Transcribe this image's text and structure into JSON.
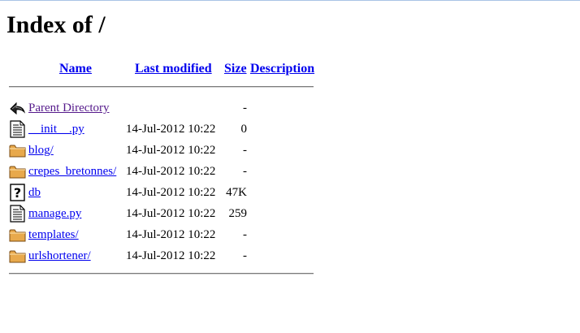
{
  "page": {
    "title": "Index of /"
  },
  "columns": {
    "name": "Name",
    "modified": "Last modified",
    "size": "Size",
    "description": "Description"
  },
  "rows": [
    {
      "icon": "back-icon",
      "name": "Parent Directory",
      "modified": "",
      "size": "-"
    },
    {
      "icon": "text-file-icon",
      "name": "__init__.py",
      "modified": "14-Jul-2012 10:22",
      "size": "0"
    },
    {
      "icon": "folder-icon",
      "name": "blog/",
      "modified": "14-Jul-2012 10:22",
      "size": "-"
    },
    {
      "icon": "folder-icon",
      "name": "crepes_bretonnes/",
      "modified": "14-Jul-2012 10:22",
      "size": "-"
    },
    {
      "icon": "unknown-file-icon",
      "name": "db",
      "modified": "14-Jul-2012 10:22",
      "size": "47K"
    },
    {
      "icon": "text-file-icon",
      "name": "manage.py",
      "modified": "14-Jul-2012 10:22",
      "size": "259"
    },
    {
      "icon": "folder-icon",
      "name": "templates/",
      "modified": "14-Jul-2012 10:22",
      "size": "-"
    },
    {
      "icon": "folder-icon",
      "name": "urlshortener/",
      "modified": "14-Jul-2012 10:22",
      "size": "-"
    }
  ]
}
